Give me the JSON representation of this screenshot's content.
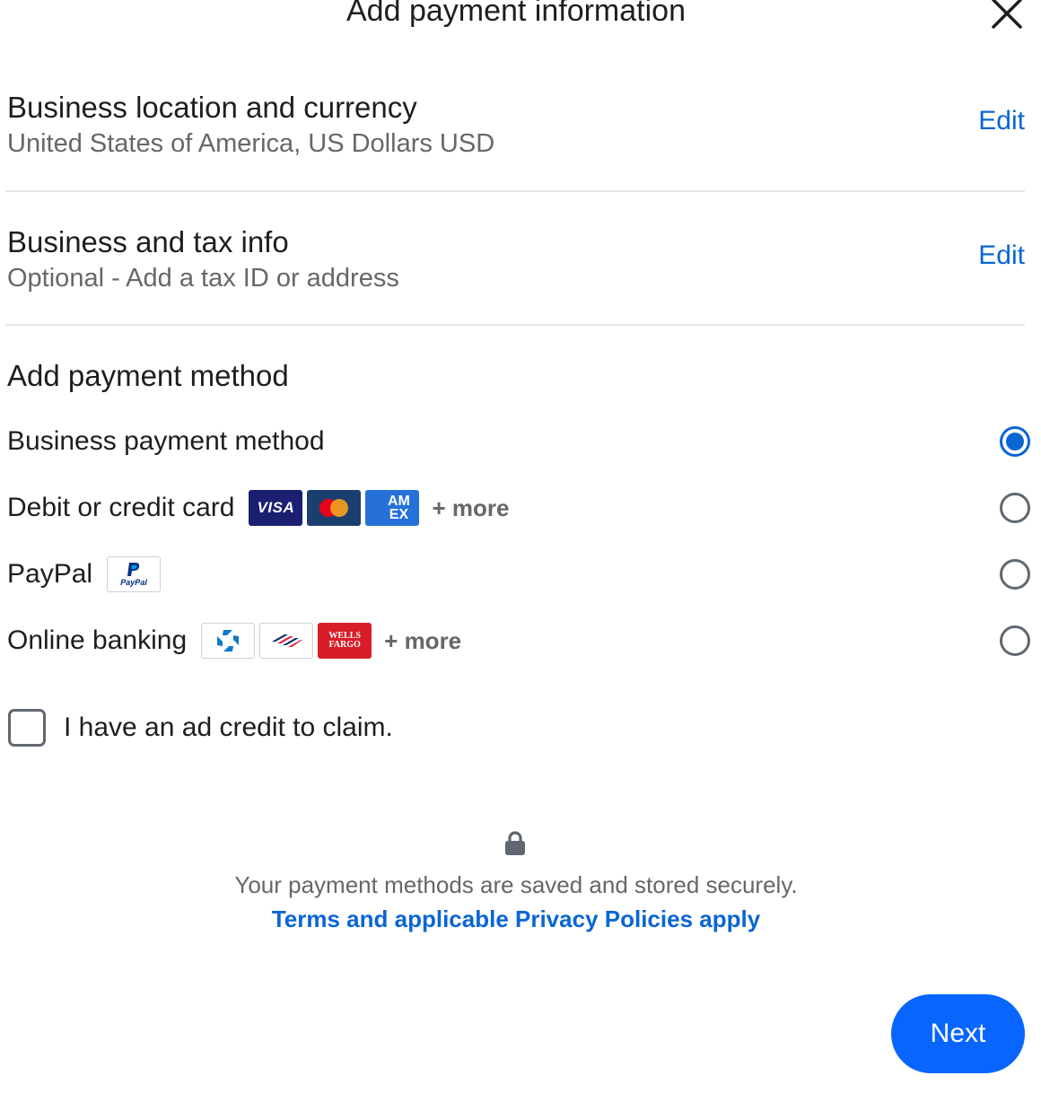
{
  "dialog": {
    "title": "Add payment information"
  },
  "location_section": {
    "title": "Business location and currency",
    "subtitle": "United States of America, US Dollars USD",
    "edit_label": "Edit"
  },
  "tax_section": {
    "title": "Business and tax info",
    "subtitle": "Optional - Add a tax ID or address",
    "edit_label": "Edit"
  },
  "payment_method": {
    "heading": "Add payment method",
    "options": [
      {
        "label": "Business payment method",
        "selected": true,
        "logos": []
      },
      {
        "label": "Debit or credit card",
        "selected": false,
        "logos": [
          "visa-logo",
          "mastercard-logo",
          "amex-logo"
        ],
        "more": "+ more"
      },
      {
        "label": "PayPal",
        "selected": false,
        "logos": [
          "paypal-logo"
        ]
      },
      {
        "label": "Online banking",
        "selected": false,
        "logos": [
          "chase-logo",
          "bank-of-america-logo",
          "wells-fargo-logo"
        ],
        "more": "+ more"
      }
    ]
  },
  "logo_text": {
    "visa": "VISA",
    "amex_top": "AM",
    "amex_bottom": "EX",
    "paypal": "PayPal",
    "wells_top": "WELLS",
    "wells_bottom": "FARGO"
  },
  "ad_credit": {
    "label": "I have an ad credit to claim.",
    "checked": false
  },
  "footer": {
    "lock_icon": "lock-icon",
    "secure_text": "Your payment methods are saved and stored securely.",
    "terms_link": "Terms and applicable Privacy Policies apply"
  },
  "actions": {
    "next_label": "Next"
  },
  "colors": {
    "accent": "#0866ff",
    "link": "#0a66d4",
    "visa": "#1a1f71",
    "mastercard_bg": "#1a3f6f",
    "amex": "#2671d9",
    "wells_fargo": "#d71e28"
  }
}
